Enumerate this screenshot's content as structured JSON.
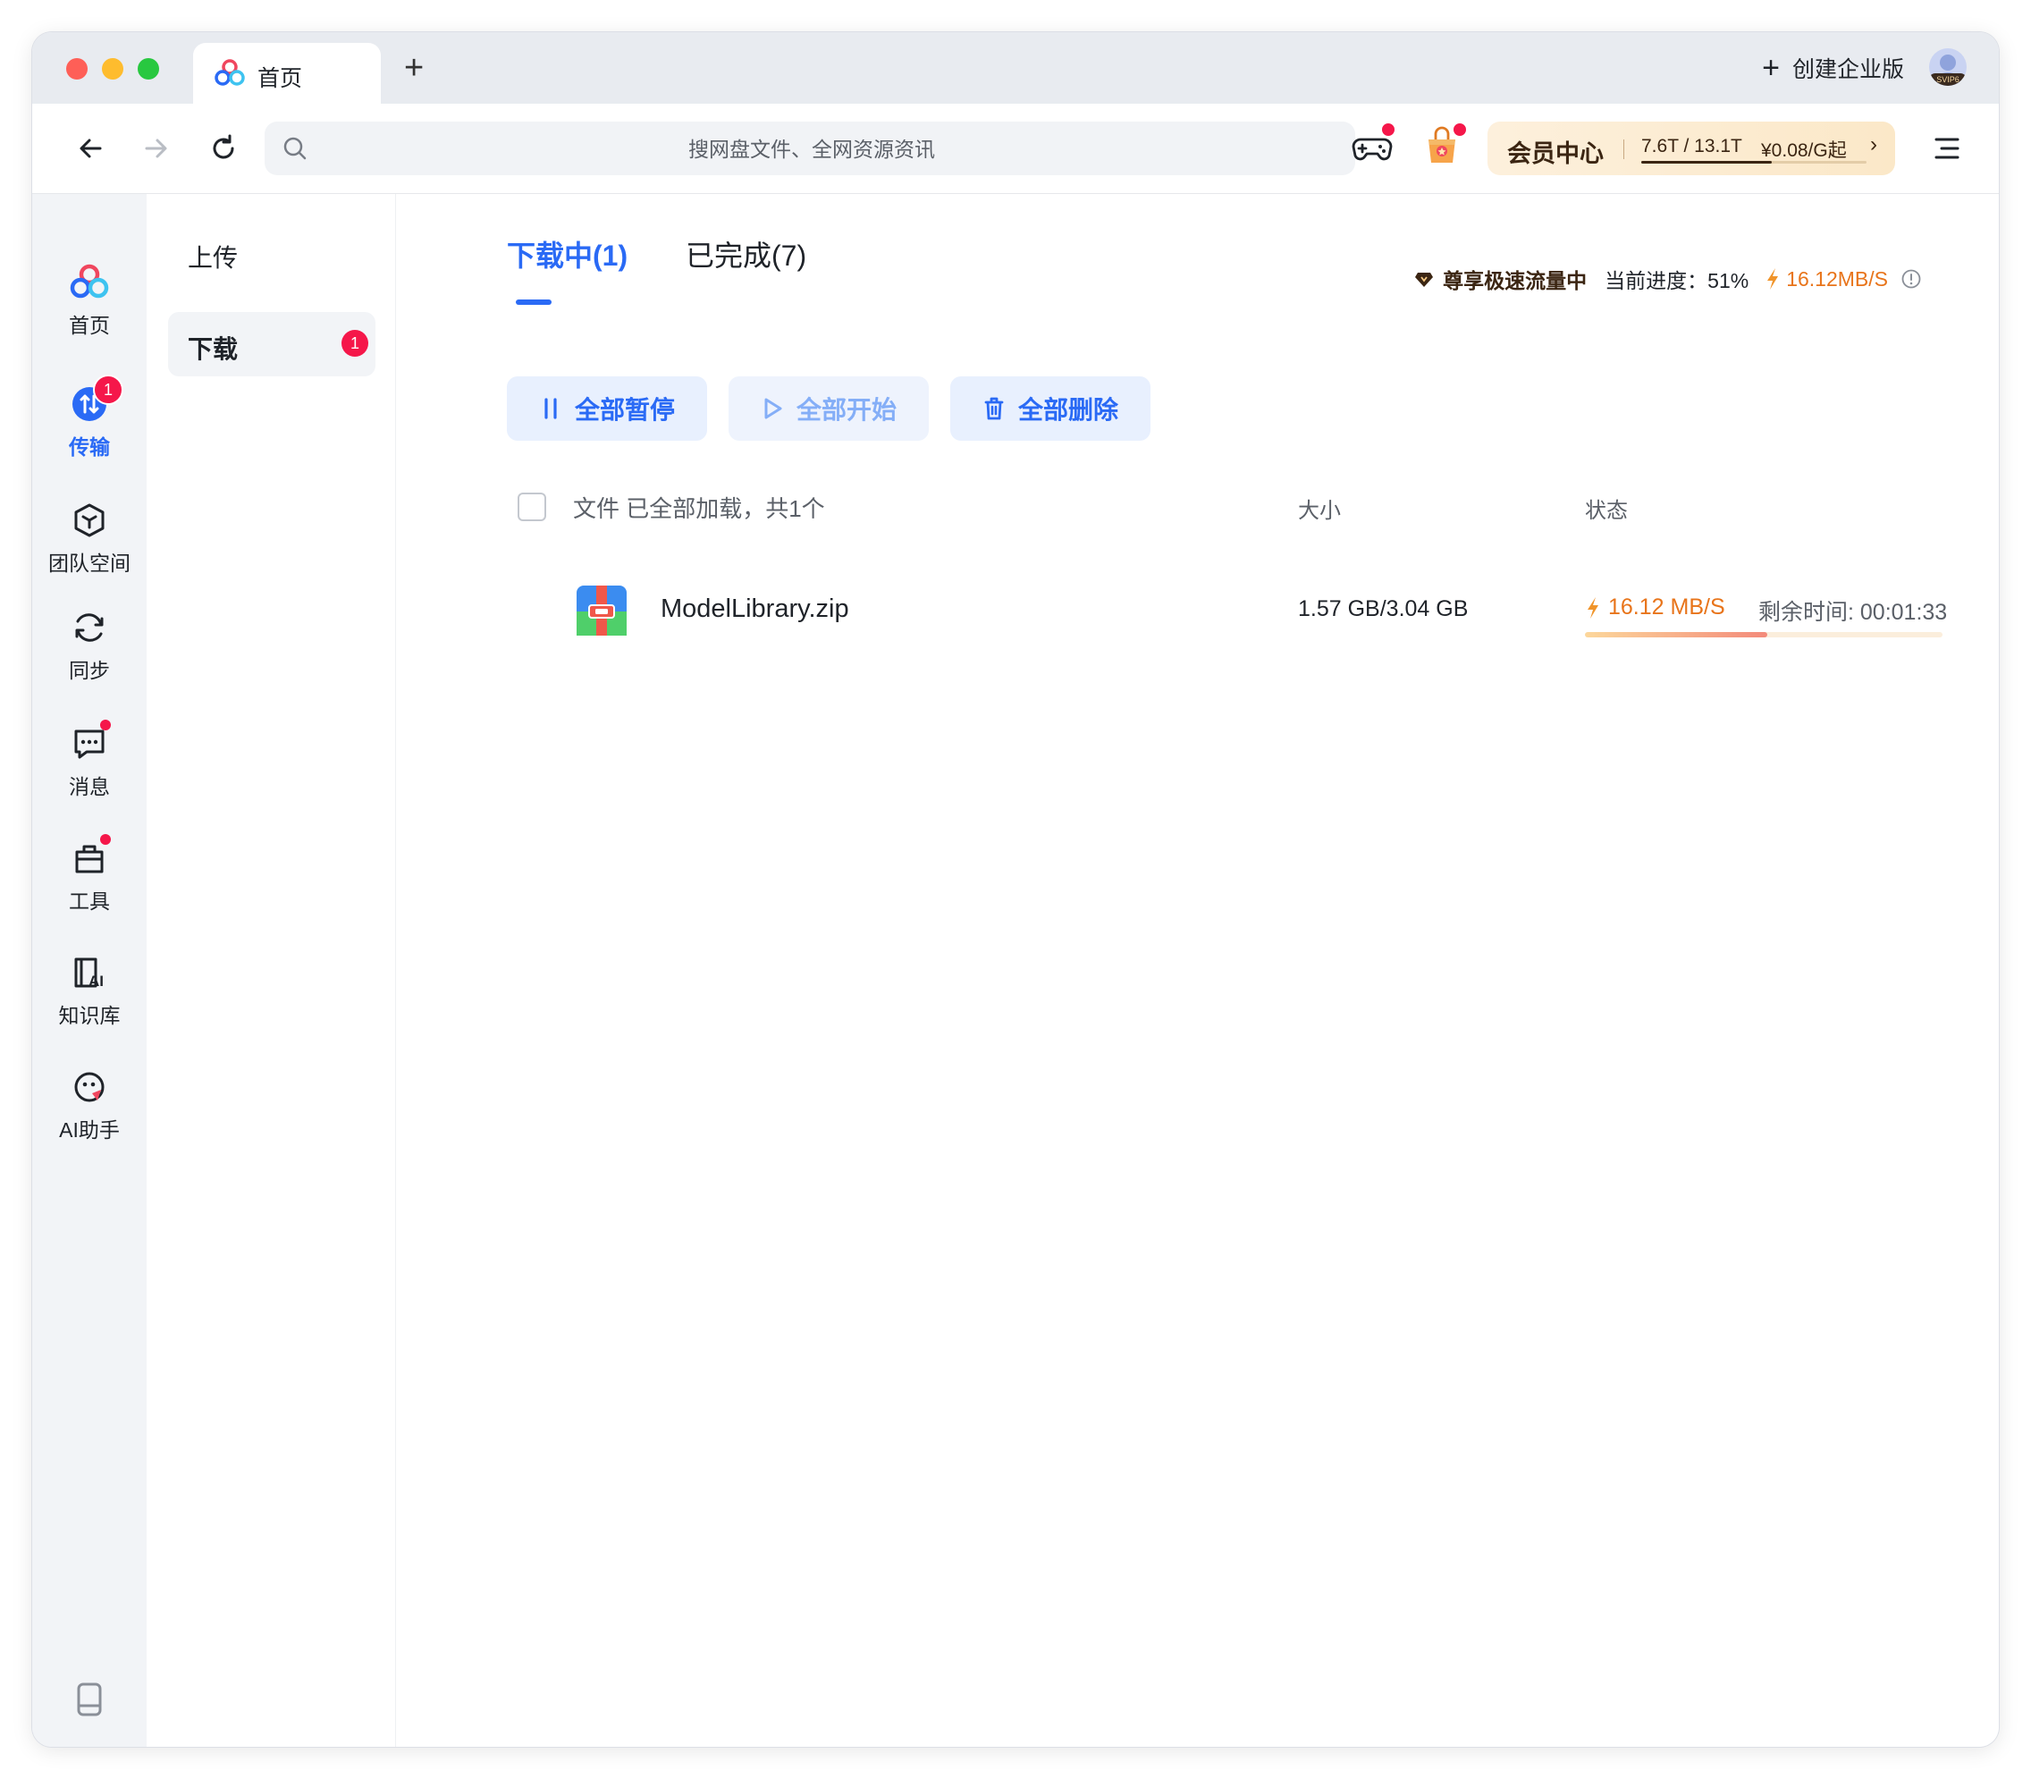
{
  "tabbar": {
    "home_tab_label": "首页",
    "new_tab_label": "+",
    "enterprise_label": "创建企业版",
    "avatar_badge": "SVIP6"
  },
  "toolbar": {
    "search_placeholder": "搜网盘文件、全网资源资讯",
    "vip": {
      "title": "会员中心",
      "quota": "7.6T / 13.1T",
      "price": "¥0.08/G起",
      "chevron": "›",
      "quota_used_fraction": 0.58
    }
  },
  "rail": {
    "items": [
      {
        "label": "首页",
        "icon": "cloud-logo-icon"
      },
      {
        "label": "传输",
        "icon": "transfer-icon",
        "badge": "1"
      },
      {
        "label": "团队空间",
        "icon": "cube-icon"
      },
      {
        "label": "同步",
        "icon": "sync-icon"
      },
      {
        "label": "消息",
        "icon": "message-icon"
      },
      {
        "label": "工具",
        "icon": "toolbox-icon"
      },
      {
        "label": "知识库",
        "icon": "ai-library-icon"
      },
      {
        "label": "AI助手",
        "icon": "ai-assistant-icon"
      }
    ]
  },
  "subside": {
    "upload_label": "上传",
    "download_label": "下载",
    "download_badge": "1"
  },
  "main": {
    "tabs": {
      "downloading": "下载中(1)",
      "completed": "已完成(7)"
    },
    "speed_info": {
      "premium_label": "尊享极速流量中",
      "progress_label": "当前进度：51%",
      "speed": "16.12MB/S"
    },
    "actions": {
      "pause_all": "全部暂停",
      "start_all": "全部开始",
      "delete_all": "全部删除"
    },
    "table": {
      "col_file": "文件 已全部加载，共1个",
      "col_size": "大小",
      "col_status": "状态"
    },
    "rows": [
      {
        "name": "ModelLibrary.zip",
        "size": "1.57 GB/3.04 GB",
        "speed": "16.12 MB/S",
        "remaining": "剩余时间: 00:01:33",
        "progress_percent": 51
      }
    ]
  },
  "colors": {
    "accent": "#2a6af5",
    "badge_red": "#f5174a",
    "speed_orange": "#e8741a"
  }
}
